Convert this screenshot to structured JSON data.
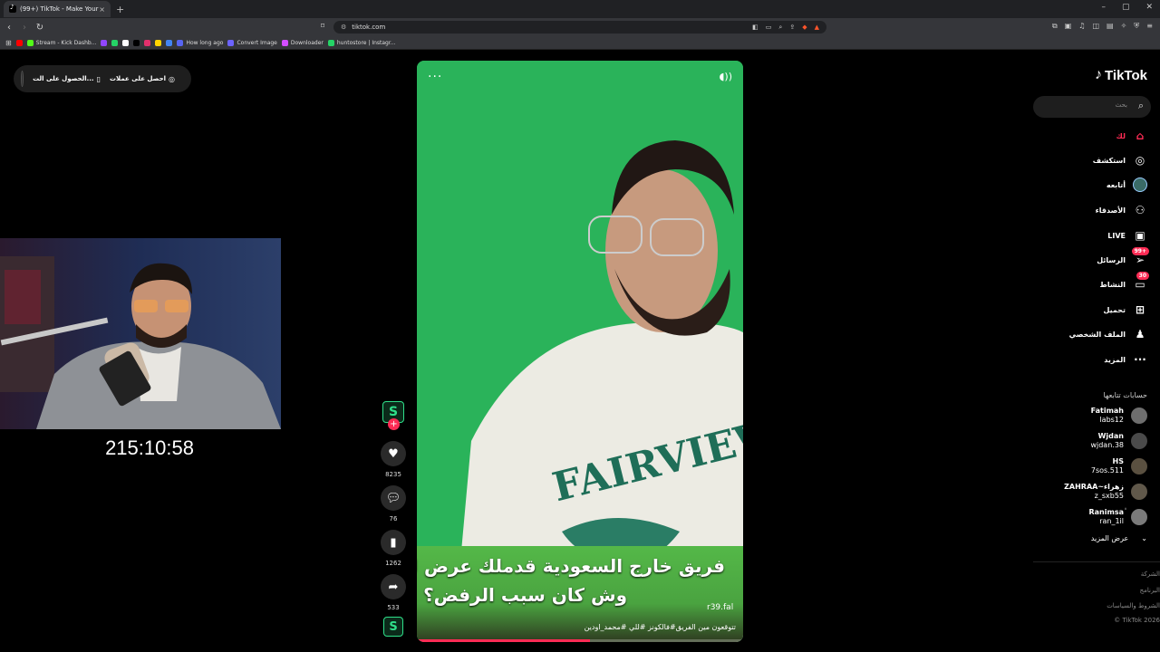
{
  "browser": {
    "tab_title": "(99+) TikTok - Make Your Day",
    "tab_close": "×",
    "new_tab": "+",
    "url": "tiktok.com",
    "bookmarks": [
      {
        "label": "",
        "color": "#ff0000"
      },
      {
        "label": "Stream - Kick Dashb...",
        "color": "#53fc18"
      },
      {
        "label": "",
        "color": "#9146ff"
      },
      {
        "label": "",
        "color": "#25d366"
      },
      {
        "label": "",
        "color": "#ffffff"
      },
      {
        "label": "",
        "color": "#000000"
      },
      {
        "label": "",
        "color": "#e1306c"
      },
      {
        "label": "",
        "color": "#ffd400"
      },
      {
        "label": "",
        "color": "#4285f4"
      },
      {
        "label": "How long ago",
        "color": "#5865f2"
      },
      {
        "label": "Convert Image",
        "color": "#6c63ff"
      },
      {
        "label": "Downloader",
        "color": "#d24dff"
      },
      {
        "label": "huntostore | Instagr...",
        "color": "#25d366"
      }
    ]
  },
  "get_app": {
    "coins_label": "احصل على عملات",
    "app_label": "الحصول على الت..."
  },
  "stream": {
    "timer": "215:10:58"
  },
  "video": {
    "more": "···",
    "caption_line1": "فريق خارج السعودية قدملك عرض لك",
    "caption_line2": "وش كان سبب الرفض؟",
    "username_overlay": "r39.fal",
    "description": "تتوقعون مين الفريق#فالكونز #للي #محمد_اودين",
    "progress": 0.53
  },
  "actions": {
    "likes": "8235",
    "comments": "76",
    "saves": "1262",
    "shares": "533"
  },
  "sidebar": {
    "logo": "TikTok",
    "search_placeholder": "بحث",
    "nav": [
      {
        "label": "لك",
        "icon": "home-icon",
        "active": true,
        "badge": ""
      },
      {
        "label": "استكشف",
        "icon": "compass-icon",
        "active": false,
        "badge": ""
      },
      {
        "label": "أتابعه",
        "icon": "following-avatar",
        "active": false,
        "badge": ""
      },
      {
        "label": "الأصدقاء",
        "icon": "friends-icon",
        "active": false,
        "badge": ""
      },
      {
        "label": "LIVE",
        "icon": "live-icon",
        "active": false,
        "badge": ""
      },
      {
        "label": "الرسائل",
        "icon": "messages-icon",
        "active": false,
        "badge": "99+"
      },
      {
        "label": "النشاط",
        "icon": "activity-icon",
        "active": false,
        "badge": "30"
      },
      {
        "label": "تحميل",
        "icon": "upload-icon",
        "active": false,
        "badge": ""
      },
      {
        "label": "الملف الشخصي",
        "icon": "profile-icon",
        "active": false,
        "badge": ""
      },
      {
        "label": "المزيد",
        "icon": "more-icon",
        "active": false,
        "badge": ""
      }
    ],
    "following_title": "حسابات تتابعها",
    "following": [
      {
        "name": "Fatimah",
        "handle": "labs12"
      },
      {
        "name": "Wjdan",
        "handle": "wjdan.38"
      },
      {
        "name": "HS",
        "handle": "7sos.511"
      },
      {
        "name": "ZAHRAA~زهراء",
        "handle": "z_sxb55"
      },
      {
        "name": "Ranimsaٰ",
        "handle": "ran_1il"
      }
    ],
    "see_more": "عرض المزيد",
    "footer": [
      "الشركة",
      "البرنامج",
      "الشروط والسياسات",
      "© TikTok 2026"
    ]
  }
}
